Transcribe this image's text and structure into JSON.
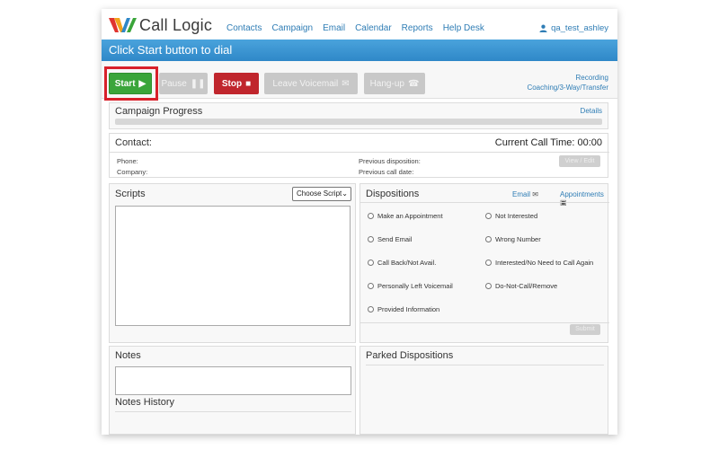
{
  "brand": {
    "name": "Call Logic"
  },
  "nav": {
    "items": [
      "Contacts",
      "Campaign",
      "Email",
      "Calendar",
      "Reports",
      "Help Desk"
    ]
  },
  "user": {
    "name": "qa_test_ashley",
    "icon": "user-icon"
  },
  "status_bar": {
    "text": "Click Start button to dial"
  },
  "toolbar": {
    "start": "Start",
    "pause": "Pause",
    "stop": "Stop",
    "leave_voicemail": "Leave Voicemail",
    "hangup": "Hang-up",
    "recording": "Recording",
    "coaching": "Coaching/3-Way/Transfer"
  },
  "campaign": {
    "title": "Campaign Progress",
    "details_link": "Details",
    "progress": 0
  },
  "contact": {
    "title": "Contact:",
    "call_time_label": "Current Call Time:",
    "call_time": "00:00",
    "phone_label": "Phone:",
    "company_label": "Company:",
    "prev_disposition_label": "Previous disposition:",
    "prev_call_date_label": "Previous call date:",
    "view_edit": "View / Edit"
  },
  "scripts": {
    "title": "Scripts",
    "select_value": "Choose Script"
  },
  "dispositions": {
    "title": "Dispositions",
    "email_link": "Email",
    "appointments_link": "Appointments",
    "submit": "Submit",
    "options_left": [
      "Make an Appointment",
      "Send Email",
      "Call Back/Not Avail.",
      "Personally Left Voicemail",
      "Provided Information"
    ],
    "options_right": [
      "Not Interested",
      "Wrong Number",
      "Interested/No Need to Call Again",
      "Do-Not-Call/Remove"
    ]
  },
  "notes": {
    "title": "Notes",
    "history_title": "Notes History"
  },
  "parked": {
    "title": "Parked Dispositions"
  },
  "colors": {
    "accent": "#2f88c8",
    "start": "#3aa53a",
    "stop": "#c0262d",
    "highlight": "#d8202a"
  }
}
